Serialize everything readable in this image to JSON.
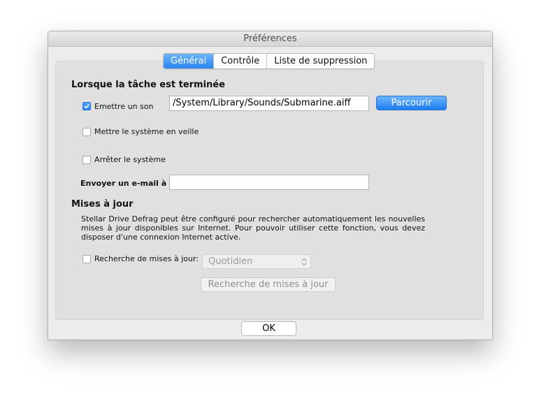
{
  "window": {
    "title": "Préférences"
  },
  "tabs": [
    {
      "label": "Général",
      "active": true
    },
    {
      "label": "Contrôle",
      "active": false
    },
    {
      "label": "Liste de suppression",
      "active": false
    }
  ],
  "completion": {
    "heading": "Lorsque la tâche est terminée",
    "play_sound": {
      "label": "Emettre un son",
      "checked": true
    },
    "sound_path": "/System/Library/Sounds/Submarine.aiff",
    "browse_button": "Parcourir",
    "sleep": {
      "label": "Mettre le système en veille",
      "checked": false
    },
    "shutdown": {
      "label": "Arrêter le système",
      "checked": false
    },
    "email_label": "Envoyer un e-mail à :",
    "email_value": ""
  },
  "updates": {
    "heading": "Mises à jour",
    "description": "Stellar Drive Defrag peut être configuré pour rechercher automatiquement les nouvelles mises à jour disponibles sur Internet. Pour pouvoir utiliser cette fonction, vous devez disposer d'une connexion Internet active.",
    "check_label": "Recherche de mises à jour:",
    "check_checked": false,
    "frequency": "Quotidien",
    "check_button": "Recherche de mises à jour"
  },
  "footer": {
    "ok_button": "OK"
  },
  "colors": {
    "accent": "#2a84f0"
  }
}
